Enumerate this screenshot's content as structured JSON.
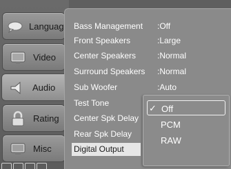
{
  "sidebar": {
    "tabs": [
      {
        "label": "Language",
        "icon": "speech-bubble-icon"
      },
      {
        "label": "Video",
        "icon": "monitor-icon"
      },
      {
        "label": "Audio",
        "icon": "speaker-icon"
      },
      {
        "label": "Rating",
        "icon": "lock-icon"
      },
      {
        "label": "Misc",
        "icon": "misc-monitor-icon"
      }
    ],
    "active_tab": "Audio"
  },
  "settings": [
    {
      "label": "Bass Management",
      "value": ":Off"
    },
    {
      "label": "Front Speakers",
      "value": ":Large"
    },
    {
      "label": "Center Speakers",
      "value": ":Normal"
    },
    {
      "label": "Surround Speakers",
      "value": ":Normal"
    },
    {
      "label": "Sub Woofer",
      "value": ":Auto"
    },
    {
      "label": "Test Tone",
      "value": ""
    },
    {
      "label": "Center Spk Delay",
      "value": ""
    },
    {
      "label": "Rear Spk Delay",
      "value": ""
    },
    {
      "label": "Digital Output",
      "value": ""
    }
  ],
  "selected_setting": "Digital Output",
  "popup": {
    "options": [
      {
        "check": "✓",
        "label": "Off",
        "checked": true
      },
      {
        "check": "",
        "label": "PCM",
        "checked": false
      },
      {
        "check": "",
        "label": "RAW",
        "checked": false
      }
    ]
  },
  "colors": {
    "background": "#5c5c5c",
    "panel": "#8a8a8a",
    "text": "#ffffff",
    "selection": "#e6e6e6"
  }
}
